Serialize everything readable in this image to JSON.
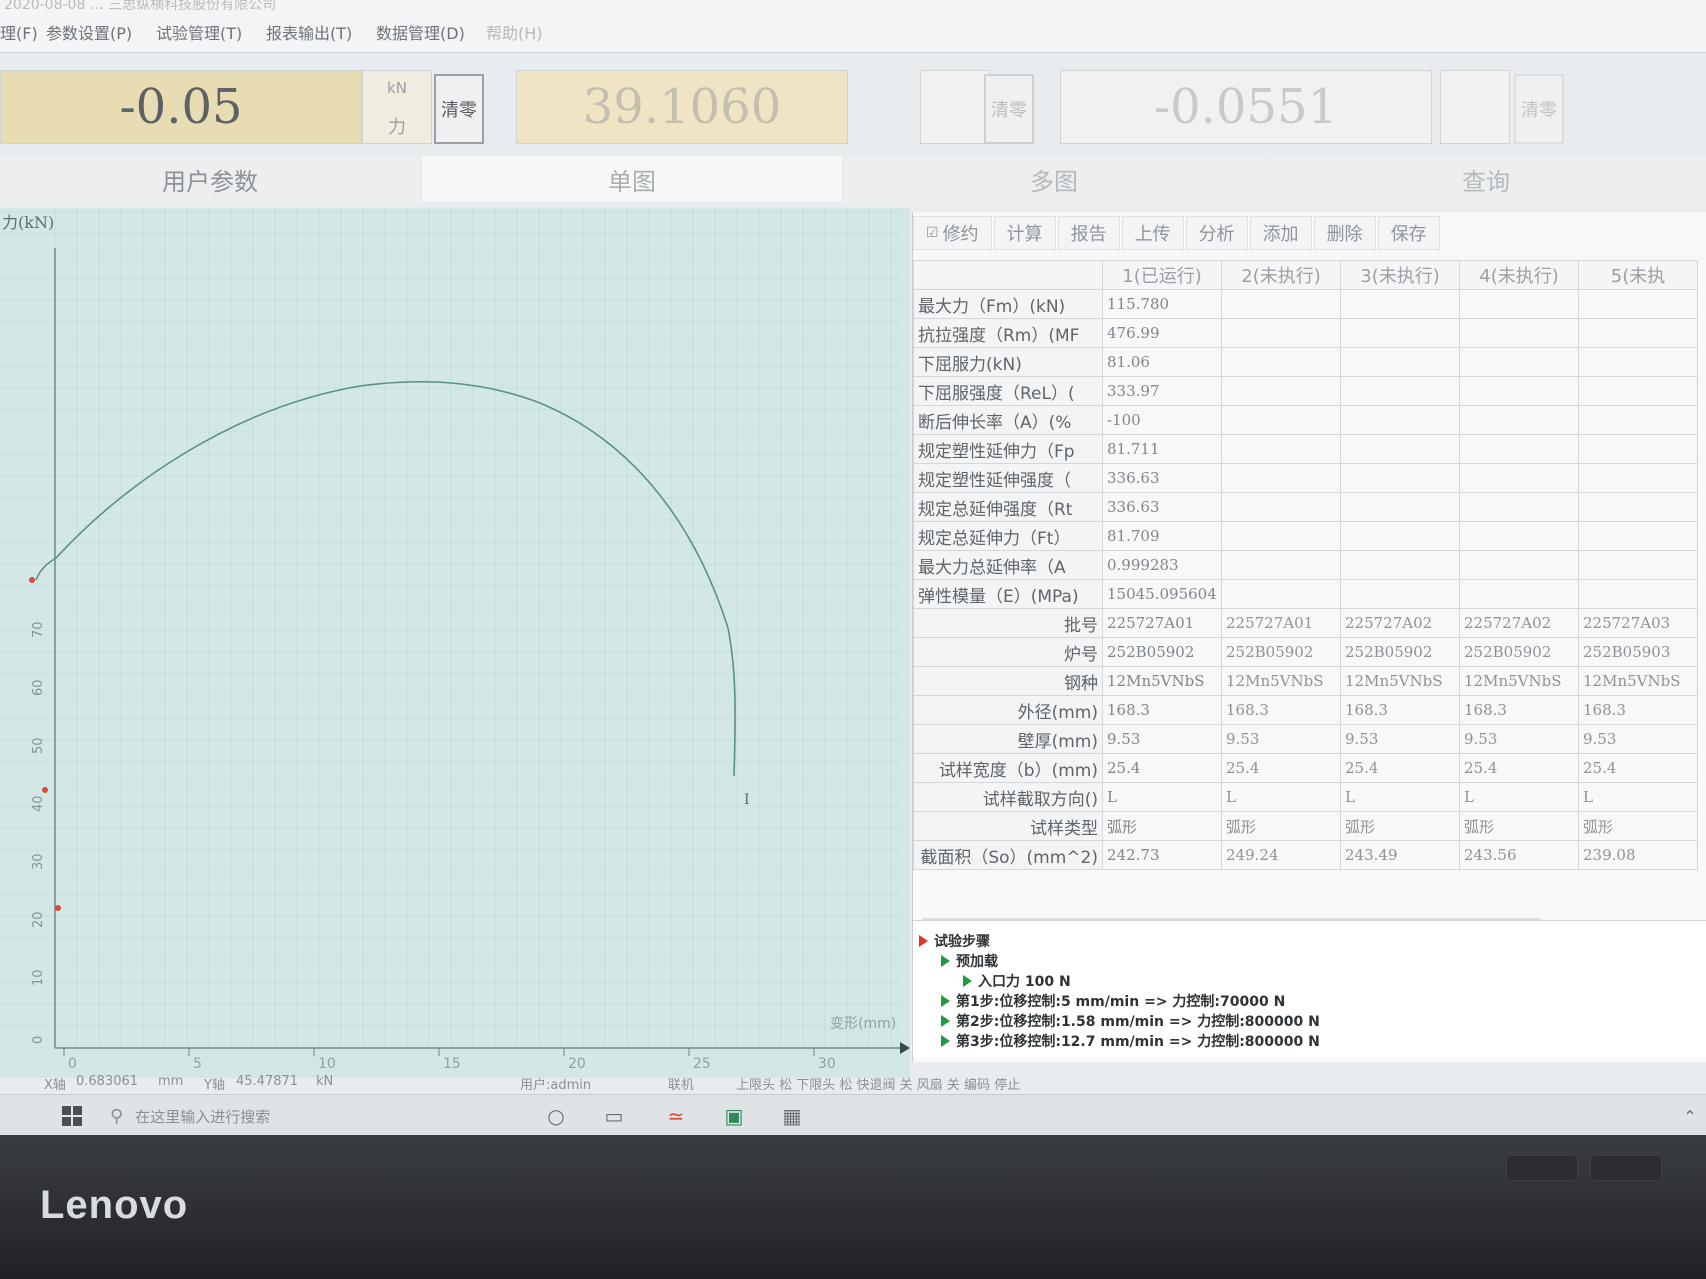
{
  "window": {
    "title": "2020-08-08 … 三思纵横科技股份有限公司"
  },
  "menu": [
    "试验管理(T)",
    "报表输出(T)",
    "数据管理(D)",
    "帮助(H)"
  ],
  "menu_partial": [
    "理(F)",
    "参数设置(P)"
  ],
  "readouts": {
    "force": {
      "value": "-0.05",
      "unit": "kN",
      "name": "力",
      "zero_label": "清零"
    },
    "displacement": {
      "value": "39.1060",
      "zero_label": "清零"
    },
    "deformation": {
      "value": "-0.0551",
      "zero_label": "清零"
    }
  },
  "tabs": [
    "用户参数",
    "单图",
    "多图",
    "查询"
  ],
  "chart": {
    "ylabel": "力(kN)",
    "xlabel": "变形(mm)",
    "x_ticks": [
      "0",
      "5",
      "10",
      "15",
      "20",
      "25",
      "30"
    ],
    "y_ticks": [
      "0",
      "10",
      "20",
      "30",
      "40",
      "50",
      "60",
      "70"
    ],
    "cursor_readout": {
      "x_label": "X轴",
      "x_value": "0.683061",
      "x_unit": "mm",
      "y_label": "Y轴",
      "y_value": "45.47871",
      "y_unit": "kN"
    }
  },
  "toolbar": [
    "修约",
    "计算",
    "报告",
    "上传",
    "分析",
    "添加",
    "删除",
    "保存"
  ],
  "runs": [
    "1(已运行)",
    "2(未执行)",
    "3(未执行)",
    "4(未执行)",
    "5(未执"
  ],
  "results": [
    {
      "label": "最大力（Fm）(kN)",
      "value": "115.780"
    },
    {
      "label": "抗拉强度（Rm）(MF",
      "value": "476.99"
    },
    {
      "label": "下屈服力(kN)",
      "value": "81.06"
    },
    {
      "label": "下屈服强度（ReL）(",
      "value": "333.97"
    },
    {
      "label": "断后伸长率（A）(%",
      "value": "-100"
    },
    {
      "label": "规定塑性延伸力（Fp",
      "value": "81.711"
    },
    {
      "label": "规定塑性延伸强度（",
      "value": "336.63"
    },
    {
      "label": "规定总延伸强度（Rt",
      "value": "336.63"
    },
    {
      "label": "规定总延伸力（Ft）",
      "value": "81.709"
    },
    {
      "label": "最大力总延伸率（A",
      "value": "0.999283"
    },
    {
      "label": "弹性模量（E）(MPa)",
      "value": "15045.095604"
    }
  ],
  "specimens": {
    "headers": [
      "批号",
      "炉号",
      "钢种",
      "外径(mm)",
      "壁厚(mm)",
      "试样宽度（b）(mm)",
      "试样截取方向()",
      "试样类型",
      "截面积（So）(mm^2)"
    ],
    "rows": [
      [
        "225727A01",
        "225727A01",
        "225727A02",
        "225727A02",
        "225727A03"
      ],
      [
        "252B05902",
        "252B05902",
        "252B05902",
        "252B05902",
        "252B05903"
      ],
      [
        "12Mn5VNbS",
        "12Mn5VNbS",
        "12Mn5VNbS",
        "12Mn5VNbS",
        "12Mn5VNbS"
      ],
      [
        "168.3",
        "168.3",
        "168.3",
        "168.3",
        "168.3"
      ],
      [
        "9.53",
        "9.53",
        "9.53",
        "9.53",
        "9.53"
      ],
      [
        "25.4",
        "25.4",
        "25.4",
        "25.4",
        "25.4"
      ],
      [
        "L",
        "L",
        "L",
        "L",
        "L"
      ],
      [
        "弧形",
        "弧形",
        "弧形",
        "弧形",
        "弧形"
      ],
      [
        "242.73",
        "249.24",
        "243.49",
        "243.56",
        "239.08"
      ]
    ]
  },
  "steps": {
    "root": "试验步骤",
    "preload": "预加载",
    "preload_force": "入口力 100 N",
    "step1": "第1步:位移控制:5 mm/min => 力控制:70000 N",
    "step2": "第2步:位移控制:1.58 mm/min => 力控制:800000 N",
    "step3": "第3步:位移控制:12.7 mm/min => 力控制:800000 N"
  },
  "status": {
    "user": "用户:admin",
    "state": "联机",
    "limits": "上限头 松   下限头 松   快退阀 关   风扇 关   编码 停止"
  },
  "taskbar": {
    "search_placeholder": "在这里输入进行搜索"
  },
  "brand": "Lenovo",
  "colors": {
    "curve": "#5a8f8a",
    "chart_bg": "#d3e8e6",
    "grid": "#b9d6d2",
    "readout_bg": "#e8dcb3"
  }
}
